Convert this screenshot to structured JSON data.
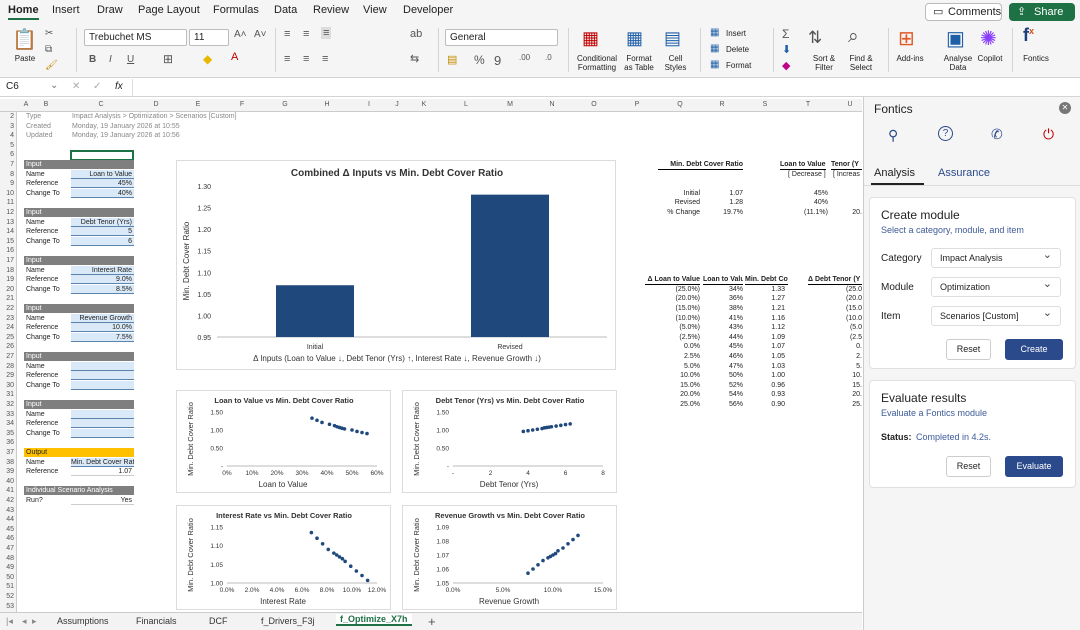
{
  "ribbon_tabs": [
    "Home",
    "Insert",
    "Draw",
    "Page Layout",
    "Formulas",
    "Data",
    "Review",
    "View",
    "Developer"
  ],
  "comments_label": "Comments",
  "share_label": "Share",
  "ribbon": {
    "paste": "Paste",
    "font_name": "Trebuchet MS",
    "font_size": "11",
    "number_format": "General",
    "conditional_formatting": [
      "Conditional",
      "Formatting"
    ],
    "format_as_table": [
      "Format",
      "as Table"
    ],
    "cell_styles": [
      "Cell",
      "Styles"
    ],
    "insert": "Insert",
    "delete": "Delete",
    "format": "Format",
    "sort_filter": [
      "Sort &",
      "Filter"
    ],
    "find_select": [
      "Find &",
      "Select"
    ],
    "addins": "Add-ins",
    "analyse_data": [
      "Analyse",
      "Data"
    ],
    "copilot": "Copilot",
    "fontics": "Fontics"
  },
  "formula_bar": {
    "name_box": "C6",
    "fx": "fx",
    "content": ""
  },
  "columns": [
    "A",
    "B",
    "C",
    "D",
    "E",
    "F",
    "G",
    "H",
    "I",
    "J",
    "K",
    "L",
    "M",
    "N",
    "O",
    "P",
    "Q",
    "R",
    "S",
    "T",
    "U"
  ],
  "rows": [
    "2",
    "3",
    "4",
    "5",
    "6",
    "7",
    "8",
    "9",
    "10",
    "11",
    "12",
    "13",
    "14",
    "15",
    "16",
    "17",
    "18",
    "19",
    "20",
    "21",
    "22",
    "23",
    "24",
    "25",
    "26",
    "27",
    "28",
    "29",
    "30",
    "31",
    "32",
    "33",
    "34",
    "35",
    "36",
    "37",
    "38",
    "39",
    "40",
    "41",
    "42",
    "43",
    "44",
    "45",
    "46",
    "47",
    "48",
    "49",
    "50",
    "51",
    "52",
    "53"
  ],
  "meta": [
    {
      "label": "Type",
      "value": "Impact Analysis > Optimization > Scenarios [Custom]"
    },
    {
      "label": "Created",
      "value": "Monday, 19 January 2026 at 10:55"
    },
    {
      "label": "Updated",
      "value": "Monday, 19 January 2026 at 10:56"
    }
  ],
  "inputs": [
    {
      "title": "Input",
      "name": "Loan to Value",
      "reference": "45%",
      "change_to": "40%"
    },
    {
      "title": "Input",
      "name": "Debt Tenor (Yrs)",
      "reference": "5",
      "change_to": "6"
    },
    {
      "title": "Input",
      "name": "Interest Rate",
      "reference": "9.0%",
      "change_to": "8.5%"
    },
    {
      "title": "Input",
      "name": "Revenue Growth",
      "reference": "10.0%",
      "change_to": "7.5%"
    },
    {
      "title": "Input",
      "name": "",
      "reference": "",
      "change_to": ""
    },
    {
      "title": "Input",
      "name": "",
      "reference": "",
      "change_to": ""
    }
  ],
  "row_labels": {
    "name": "Name",
    "reference": "Reference",
    "change_to": "Change To"
  },
  "output": {
    "title": "Output",
    "name_label": "Name",
    "name": "Min. Debt Cover Ratio",
    "reference_label": "Reference",
    "reference": "1.07"
  },
  "individual": {
    "title": "Individual Scenario Analysis",
    "run_label": "Run?",
    "run": "Yes"
  },
  "summary_table": {
    "headers": [
      "Min. Debt Cover Ratio",
      "Loan to Value",
      "Tenor (Y"
    ],
    "sub_headers": [
      "[ Decrease ]",
      "[ Increas"
    ],
    "rows": [
      {
        "label": "Initial",
        "dcr": "1.07",
        "ltv": "45%",
        "tenor": ""
      },
      {
        "label": "Revised",
        "dcr": "1.28",
        "ltv": "40%",
        "tenor": ""
      },
      {
        "label": "% Change",
        "dcr": "19.7%",
        "ltv": "(11.1%)",
        "tenor": "20."
      }
    ]
  },
  "sens_table": {
    "headers": [
      "Δ Loan to Value",
      "Loan to Value",
      "Min. Debt Cover Ratio",
      "Δ Debt Tenor (Y"
    ],
    "rows": [
      [
        "(25.0%)",
        "34%",
        "1.33",
        "(25.0"
      ],
      [
        "(20.0%)",
        "36%",
        "1.27",
        "(20.0"
      ],
      [
        "(15.0%)",
        "38%",
        "1.21",
        "(15.0"
      ],
      [
        "(10.0%)",
        "41%",
        "1.16",
        "(10.0"
      ],
      [
        "(5.0%)",
        "43%",
        "1.12",
        "(5.0"
      ],
      [
        "(2.5%)",
        "44%",
        "1.09",
        "(2.5"
      ],
      [
        "0.0%",
        "45%",
        "1.07",
        "0."
      ],
      [
        "2.5%",
        "46%",
        "1.05",
        "2."
      ],
      [
        "5.0%",
        "47%",
        "1.03",
        "5."
      ],
      [
        "10.0%",
        "50%",
        "1.00",
        "10."
      ],
      [
        "15.0%",
        "52%",
        "0.96",
        "15."
      ],
      [
        "20.0%",
        "54%",
        "0.93",
        "20."
      ],
      [
        "25.0%",
        "56%",
        "0.90",
        "25."
      ]
    ]
  },
  "chart_data": [
    {
      "type": "bar",
      "title": "Combined Δ Inputs vs Min. Debt Cover Ratio",
      "categories": [
        "Initial",
        "Revised"
      ],
      "values": [
        1.07,
        1.28
      ],
      "ylabel": "Min. Debt Cover Ratio",
      "xlabel": "Δ Inputs (Loan to Value ↓, Debt Tenor (Yrs) ↑, Interest Rate ↓, Revenue Growth ↓)",
      "ylim": [
        0.95,
        1.3
      ],
      "yticks": [
        "1.30",
        "1.25",
        "1.20",
        "1.15",
        "1.10",
        "1.05",
        "1.00",
        "0.95"
      ],
      "color": "#1f497d"
    },
    {
      "type": "scatter",
      "title": "Loan to Value vs Min. Debt Cover Ratio",
      "xlabel": "Loan to Value",
      "ylabel": "Min. Debt Cover Ratio",
      "xlim": [
        0,
        60
      ],
      "ylim": [
        0,
        1.5
      ],
      "xticks": [
        "0%",
        "10%",
        "20%",
        "30%",
        "40%",
        "50%",
        "60%"
      ],
      "yticks": [
        "1.50",
        "1.00",
        "0.50",
        "-"
      ],
      "x": [
        34,
        36,
        38,
        41,
        43,
        44,
        45,
        46,
        47,
        50,
        52,
        54,
        56
      ],
      "y": [
        1.33,
        1.27,
        1.21,
        1.16,
        1.12,
        1.09,
        1.07,
        1.05,
        1.03,
        1.0,
        0.96,
        0.93,
        0.9
      ]
    },
    {
      "type": "scatter",
      "title": "Debt Tenor (Yrs) vs Min. Debt Cover Ratio",
      "xlabel": "Debt Tenor (Yrs)",
      "ylabel": "Min. Debt Cover Ratio",
      "xlim": [
        0,
        8
      ],
      "ylim": [
        0,
        1.5
      ],
      "xticks": [
        "-",
        "2",
        "4",
        "6",
        "8"
      ],
      "yticks": [
        "1.50",
        "1.00",
        "0.50",
        "-"
      ],
      "x": [
        3.75,
        4.0,
        4.25,
        4.5,
        4.75,
        4.875,
        5,
        5.125,
        5.25,
        5.5,
        5.75,
        6.0,
        6.25
      ],
      "y": [
        0.96,
        0.98,
        1.0,
        1.02,
        1.04,
        1.06,
        1.07,
        1.08,
        1.09,
        1.11,
        1.13,
        1.15,
        1.17
      ]
    },
    {
      "type": "scatter",
      "title": "Interest Rate vs Min. Debt Cover Ratio",
      "xlabel": "Interest Rate",
      "ylabel": "Min. Debt Cover Ratio",
      "xlim": [
        0,
        12
      ],
      "ylim": [
        1.0,
        1.15
      ],
      "xticks": [
        "0.0%",
        "2.0%",
        "4.0%",
        "6.0%",
        "8.0%",
        "10.0%",
        "12.0%"
      ],
      "yticks": [
        "1.15",
        "1.10",
        "1.05",
        "1.00"
      ],
      "x": [
        6.75,
        7.2,
        7.65,
        8.1,
        8.55,
        8.78,
        9.0,
        9.23,
        9.45,
        9.9,
        10.35,
        10.8,
        11.25
      ],
      "y": [
        1.135,
        1.12,
        1.105,
        1.09,
        1.08,
        1.075,
        1.07,
        1.065,
        1.058,
        1.045,
        1.032,
        1.02,
        1.007
      ]
    },
    {
      "type": "scatter",
      "title": "Revenue Growth vs Min. Debt Cover Ratio",
      "xlabel": "Revenue Growth",
      "ylabel": "Min. Debt Cover Ratio",
      "xlim": [
        0,
        15
      ],
      "ylim": [
        1.05,
        1.09
      ],
      "xticks": [
        "0.0%",
        "5.0%",
        "10.0%",
        "15.0%"
      ],
      "yticks": [
        "1.09",
        "1.08",
        "1.07",
        "1.06",
        "1.05"
      ],
      "x": [
        7.5,
        8.0,
        8.5,
        9.0,
        9.5,
        9.75,
        10,
        10.25,
        10.5,
        11.0,
        11.5,
        12.0,
        12.5
      ],
      "y": [
        1.057,
        1.06,
        1.063,
        1.066,
        1.068,
        1.069,
        1.07,
        1.071,
        1.073,
        1.075,
        1.078,
        1.081,
        1.084
      ]
    }
  ],
  "sheet_tabs": [
    "Assumptions",
    "Financials",
    "DCF",
    "f_Drivers_F3j",
    "f_Optimize_X7h"
  ],
  "pane": {
    "title": "Fontics",
    "tabs": [
      "Analysis",
      "Assurance"
    ],
    "create": {
      "title": "Create module",
      "subtitle": "Select a category, module, and item",
      "category_label": "Category",
      "category": "Impact Analysis",
      "module_label": "Module",
      "module": "Optimization",
      "item_label": "Item",
      "item": "Scenarios [Custom]",
      "reset": "Reset",
      "create": "Create"
    },
    "evaluate": {
      "title": "Evaluate results",
      "subtitle": "Evaluate a Fontics module",
      "status_label": "Status:",
      "status": "Completed in 4.2s.",
      "reset": "Reset",
      "evaluate": "Evaluate"
    }
  }
}
